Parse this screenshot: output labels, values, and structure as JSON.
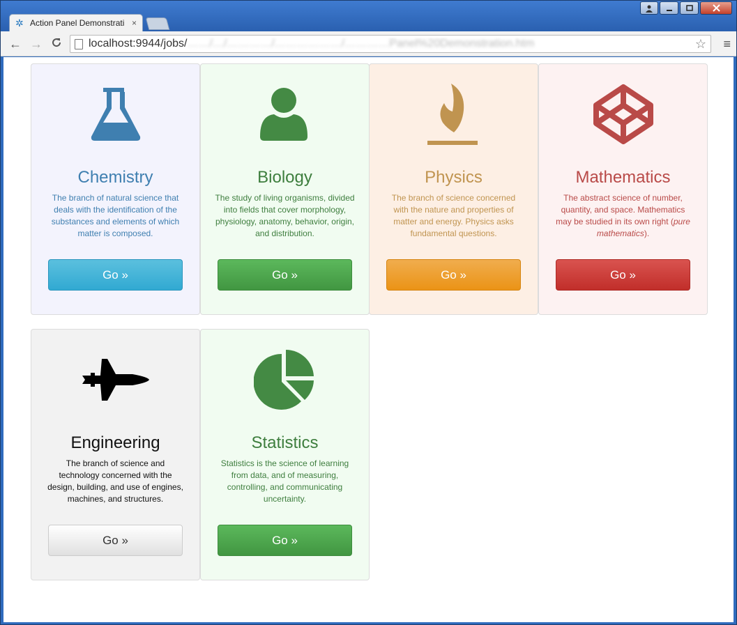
{
  "browser": {
    "tab_title": "Action Panel Demonstrati",
    "tab_close": "×",
    "url": "localhost:9944/jobs/",
    "url_obscured": "……/…/…………/………………/…………Panel%20Demonstration.htm",
    "back": "←",
    "forward": "→",
    "reload": "C",
    "star": "☆",
    "menu": "≡"
  },
  "cards": [
    {
      "title": "Chemistry",
      "description": "The branch of natural science that deals with the identification of the substances and elements of which matter is composed.",
      "button": "Go »",
      "icon": "flask-icon",
      "color": "#3f7fb0"
    },
    {
      "title": "Biology",
      "description": "The study of living organisms, divided into fields that cover morphology, physiology, anatomy, behavior, origin, and distribution.",
      "button": "Go »",
      "icon": "user-icon",
      "color": "#3e7e3e"
    },
    {
      "title": "Physics",
      "description": "The branch of science concerned with the nature and properties of matter and energy. Physics asks fundamental questions.",
      "button": "Go »",
      "icon": "fire-icon",
      "color": "#c09450"
    },
    {
      "title": "Mathematics",
      "description_before": "The abstract science of number, quantity, and space. Mathematics may be studied in its own right (",
      "description_em": "pure mathematics",
      "description_after": ").",
      "button": "Go »",
      "icon": "codepen-icon",
      "color": "#b94a48"
    },
    {
      "title": "Engineering",
      "description": "The branch of science and technology concerned with the design, building, and use of engines, machines, and structures.",
      "button": "Go »",
      "icon": "fighter-jet-icon",
      "color": "#000000"
    },
    {
      "title": "Statistics",
      "description": "Statistics is the science of learning from data, and of measuring, controlling, and communicating uncertainty.",
      "button": "Go »",
      "icon": "pie-chart-icon",
      "color": "#3e7e3e"
    }
  ]
}
